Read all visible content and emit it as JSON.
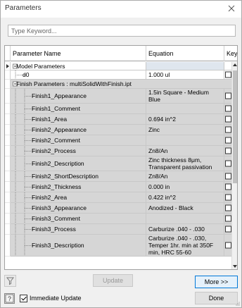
{
  "window": {
    "title": "Parameters"
  },
  "search": {
    "placeholder": "Type Keyword..."
  },
  "grid": {
    "columns": {
      "name": "Parameter Name",
      "equation": "Equation",
      "key": "Key"
    },
    "rows": [
      {
        "type": "group",
        "name": "Model Parameters",
        "equation": ""
      },
      {
        "type": "param",
        "name": "d0",
        "equation": "1.000 ul",
        "style": "white"
      },
      {
        "type": "group2",
        "name": "Finish Parameters : multiSolidWithFinish.ipt",
        "equation": ""
      },
      {
        "type": "param",
        "name": "Finish1_Appearance",
        "equation": "1.5in Square - Medium Blue"
      },
      {
        "type": "param",
        "name": "Finish1_Comment",
        "equation": ""
      },
      {
        "type": "param",
        "name": "Finish1_Area",
        "equation": "0.694 in^2"
      },
      {
        "type": "param",
        "name": "Finish2_Appearance",
        "equation": "Zinc"
      },
      {
        "type": "param",
        "name": "Finish2_Comment",
        "equation": ""
      },
      {
        "type": "param",
        "name": "Finish2_Process",
        "equation": "Zn8/An"
      },
      {
        "type": "param",
        "name": "Finish2_Description",
        "equation": "Zinc thickness 8μm, Transparent passivation"
      },
      {
        "type": "param",
        "name": "Finish2_ShortDescription",
        "equation": "Zn8/An"
      },
      {
        "type": "param",
        "name": "Finish2_Thickness",
        "equation": "0.000 in"
      },
      {
        "type": "param",
        "name": "Finish2_Area",
        "equation": "0.422 in^2"
      },
      {
        "type": "param",
        "name": "Finish3_Appearance",
        "equation": "Anodized - Black"
      },
      {
        "type": "param",
        "name": "Finish3_Comment",
        "equation": ""
      },
      {
        "type": "param",
        "name": "Finish3_Process",
        "equation": "Carburize .040 - .030"
      },
      {
        "type": "param",
        "name": "Finish3_Description",
        "equation": "Carburize .040 - .030, Temper 1hr. min at 350F min, HRC 55-60"
      }
    ]
  },
  "buttons": {
    "update": "Update",
    "more": "More >>",
    "done": "Done",
    "immediate_update": "Immediate Update"
  },
  "colors": {
    "accent": "#0078d7",
    "row_gray": "#d6d6d6"
  }
}
